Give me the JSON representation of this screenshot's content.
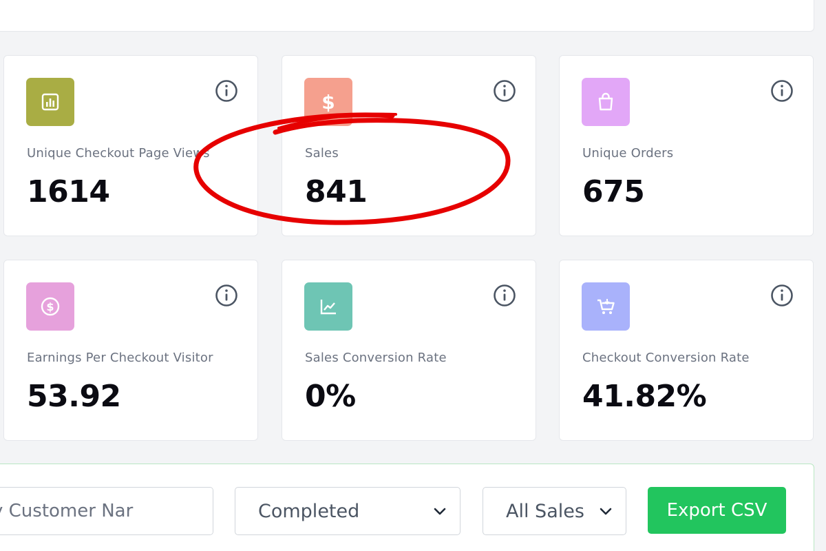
{
  "colors": {
    "views_tile": "#a9ad44",
    "sales_tile": "#f5a08e",
    "orders_tile": "#e2a7f7",
    "earnings_tile": "#e6a1dc",
    "conversion_tile": "#6ec5b4",
    "checkout_conv_tile": "#a9b2fb",
    "export_button": "#22c55e",
    "annotation": "#e60000"
  },
  "cards": [
    {
      "icon": "bar-chart-icon",
      "label": "Unique Checkout Page Views",
      "value": "1614"
    },
    {
      "icon": "dollar-icon",
      "label": "Sales",
      "value": "841"
    },
    {
      "icon": "shopping-bag-icon",
      "label": "Unique Orders",
      "value": "675"
    },
    {
      "icon": "coin-icon",
      "label": "Earnings Per Checkout Visitor",
      "value": "53.92"
    },
    {
      "icon": "line-chart-icon",
      "label": "Sales Conversion Rate",
      "value": "0%"
    },
    {
      "icon": "cart-icon",
      "label": "Checkout Conversion Rate",
      "value": "41.82%"
    }
  ],
  "filters": {
    "search_placeholder": "y Customer Nar",
    "status_selected": "Completed",
    "sales_selected": "All Sales",
    "export_label": "Export CSV"
  }
}
